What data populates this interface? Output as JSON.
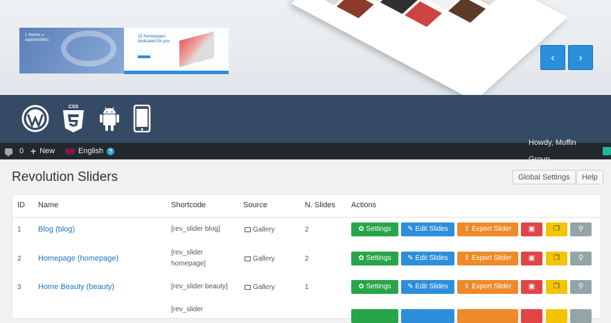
{
  "hero": {
    "thumb1_text": "1 theme\n ∞ opportunities",
    "thumb2_text": "15 homepages dedicated for you",
    "prev_label": "‹",
    "next_label": "›"
  },
  "platform_icons": [
    "wordpress-icon",
    "css3-icon",
    "android-icon",
    "mobile-icon"
  ],
  "css_label": "CSS",
  "adminbar": {
    "comments_count": "0",
    "new_label": "New",
    "language": "English",
    "greeting": "Howdy, Muffin Group"
  },
  "page": {
    "title": "Revolution Sliders",
    "global_settings": "Global Settings",
    "help": "Help"
  },
  "table": {
    "headers": [
      "ID",
      "Name",
      "Shortcode",
      "Source",
      "N. Slides",
      "Actions"
    ],
    "rows": [
      {
        "id": "1",
        "name": "Blog (blog)",
        "shortcode": "[rev_slider blog]",
        "source": "Gallery",
        "slides": "2"
      },
      {
        "id": "2",
        "name": "Homepage (homepage)",
        "shortcode": "[rev_slider homepage]",
        "source": "Gallery",
        "slides": "2"
      },
      {
        "id": "3",
        "name": "Home Beauty (beauty)",
        "shortcode": "[rev_slider beauty]",
        "source": "Gallery",
        "slides": "1"
      },
      {
        "id": "",
        "name": "",
        "shortcode": "[rev_slider",
        "source": "",
        "slides": ""
      }
    ],
    "actions": {
      "settings": "Settings",
      "edit": "Edit Slides",
      "export": "Export Slider"
    }
  },
  "colors": {
    "band": "#354a65",
    "settings": "#27a548",
    "edit": "#2d8fdb",
    "export": "#ef8a2a",
    "delete": "#e04545",
    "duplicate": "#f2c500",
    "preview": "#95a5a6"
  }
}
